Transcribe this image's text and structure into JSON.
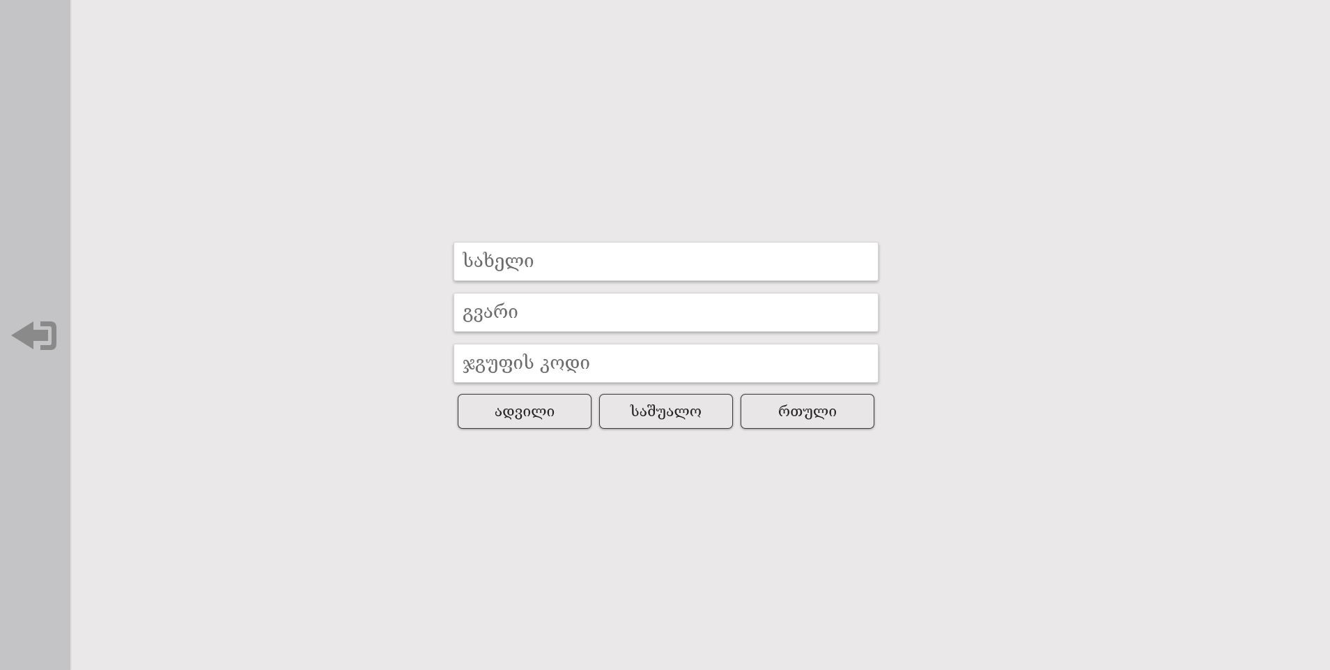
{
  "sidebar": {
    "back_icon": "sign-in-arrow-left-icon",
    "icon_color": "#8a8a8a",
    "background": "#c4c4c6"
  },
  "form": {
    "first_name": {
      "placeholder": "სახელი",
      "value": ""
    },
    "last_name": {
      "placeholder": "გვარი",
      "value": ""
    },
    "group_code": {
      "placeholder": "ჯგუფის კოდი",
      "value": ""
    }
  },
  "difficulty": {
    "easy_label": "ადვილი",
    "medium_label": "საშუალო",
    "hard_label": "რთული"
  },
  "colors": {
    "page_background": "#eae8e9",
    "button_background": "#e8e6e7",
    "button_border": "#3c3c3c"
  }
}
